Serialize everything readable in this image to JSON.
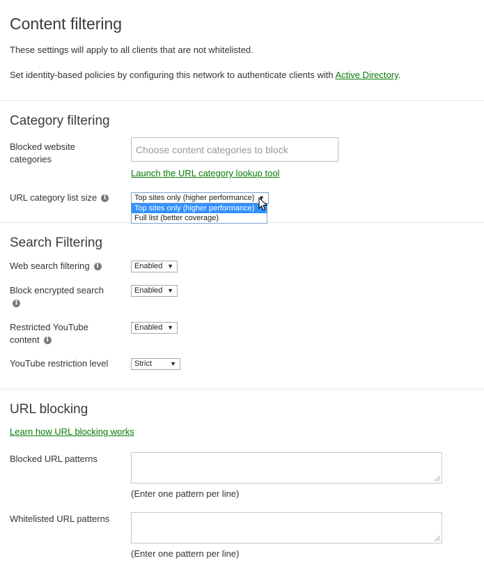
{
  "page": {
    "title": "Content filtering",
    "intro": "These settings will apply to all clients that are not whitelisted.",
    "identity_text": "Set identity-based policies by configuring this network to authenticate clients with ",
    "identity_link": "Active Directory",
    "identity_suffix": "."
  },
  "category_filtering": {
    "heading": "Category filtering",
    "blocked_label": "Blocked website categories",
    "blocked_placeholder": "Choose content categories to block",
    "lookup_link": "Launch the URL category lookup tool",
    "list_size_label": "URL category list size",
    "list_size_value": "Top sites only (higher performance)",
    "list_size_options": [
      "Top sites only (higher performance)",
      "Full list (better coverage)"
    ],
    "list_size_selected_index": 0
  },
  "search_filtering": {
    "heading": "Search Filtering",
    "web_search_label": "Web search filtering",
    "web_search_value": "Enabled",
    "encrypted_label": "Block encrypted search",
    "encrypted_value": "Enabled",
    "youtube_label_1": "Restricted YouTube",
    "youtube_label_2": "content",
    "youtube_value": "Enabled",
    "youtube_level_label": "YouTube restriction level",
    "youtube_level_value": "Strict"
  },
  "url_blocking": {
    "heading": "URL blocking",
    "learn_link": "Learn how URL blocking works",
    "blocked_label": "Blocked URL patterns",
    "blocked_value": "",
    "blocked_hint": "(Enter one pattern per line)",
    "whitelist_label": "Whitelisted URL patterns",
    "whitelist_value": "",
    "whitelist_hint": "(Enter one pattern per line)"
  },
  "icons": {
    "info": "i",
    "dropdown_arrow": "▼"
  },
  "colors": {
    "link": "#067a06",
    "selected_option": "#3390ff",
    "info_icon": "#7a7a7a"
  }
}
